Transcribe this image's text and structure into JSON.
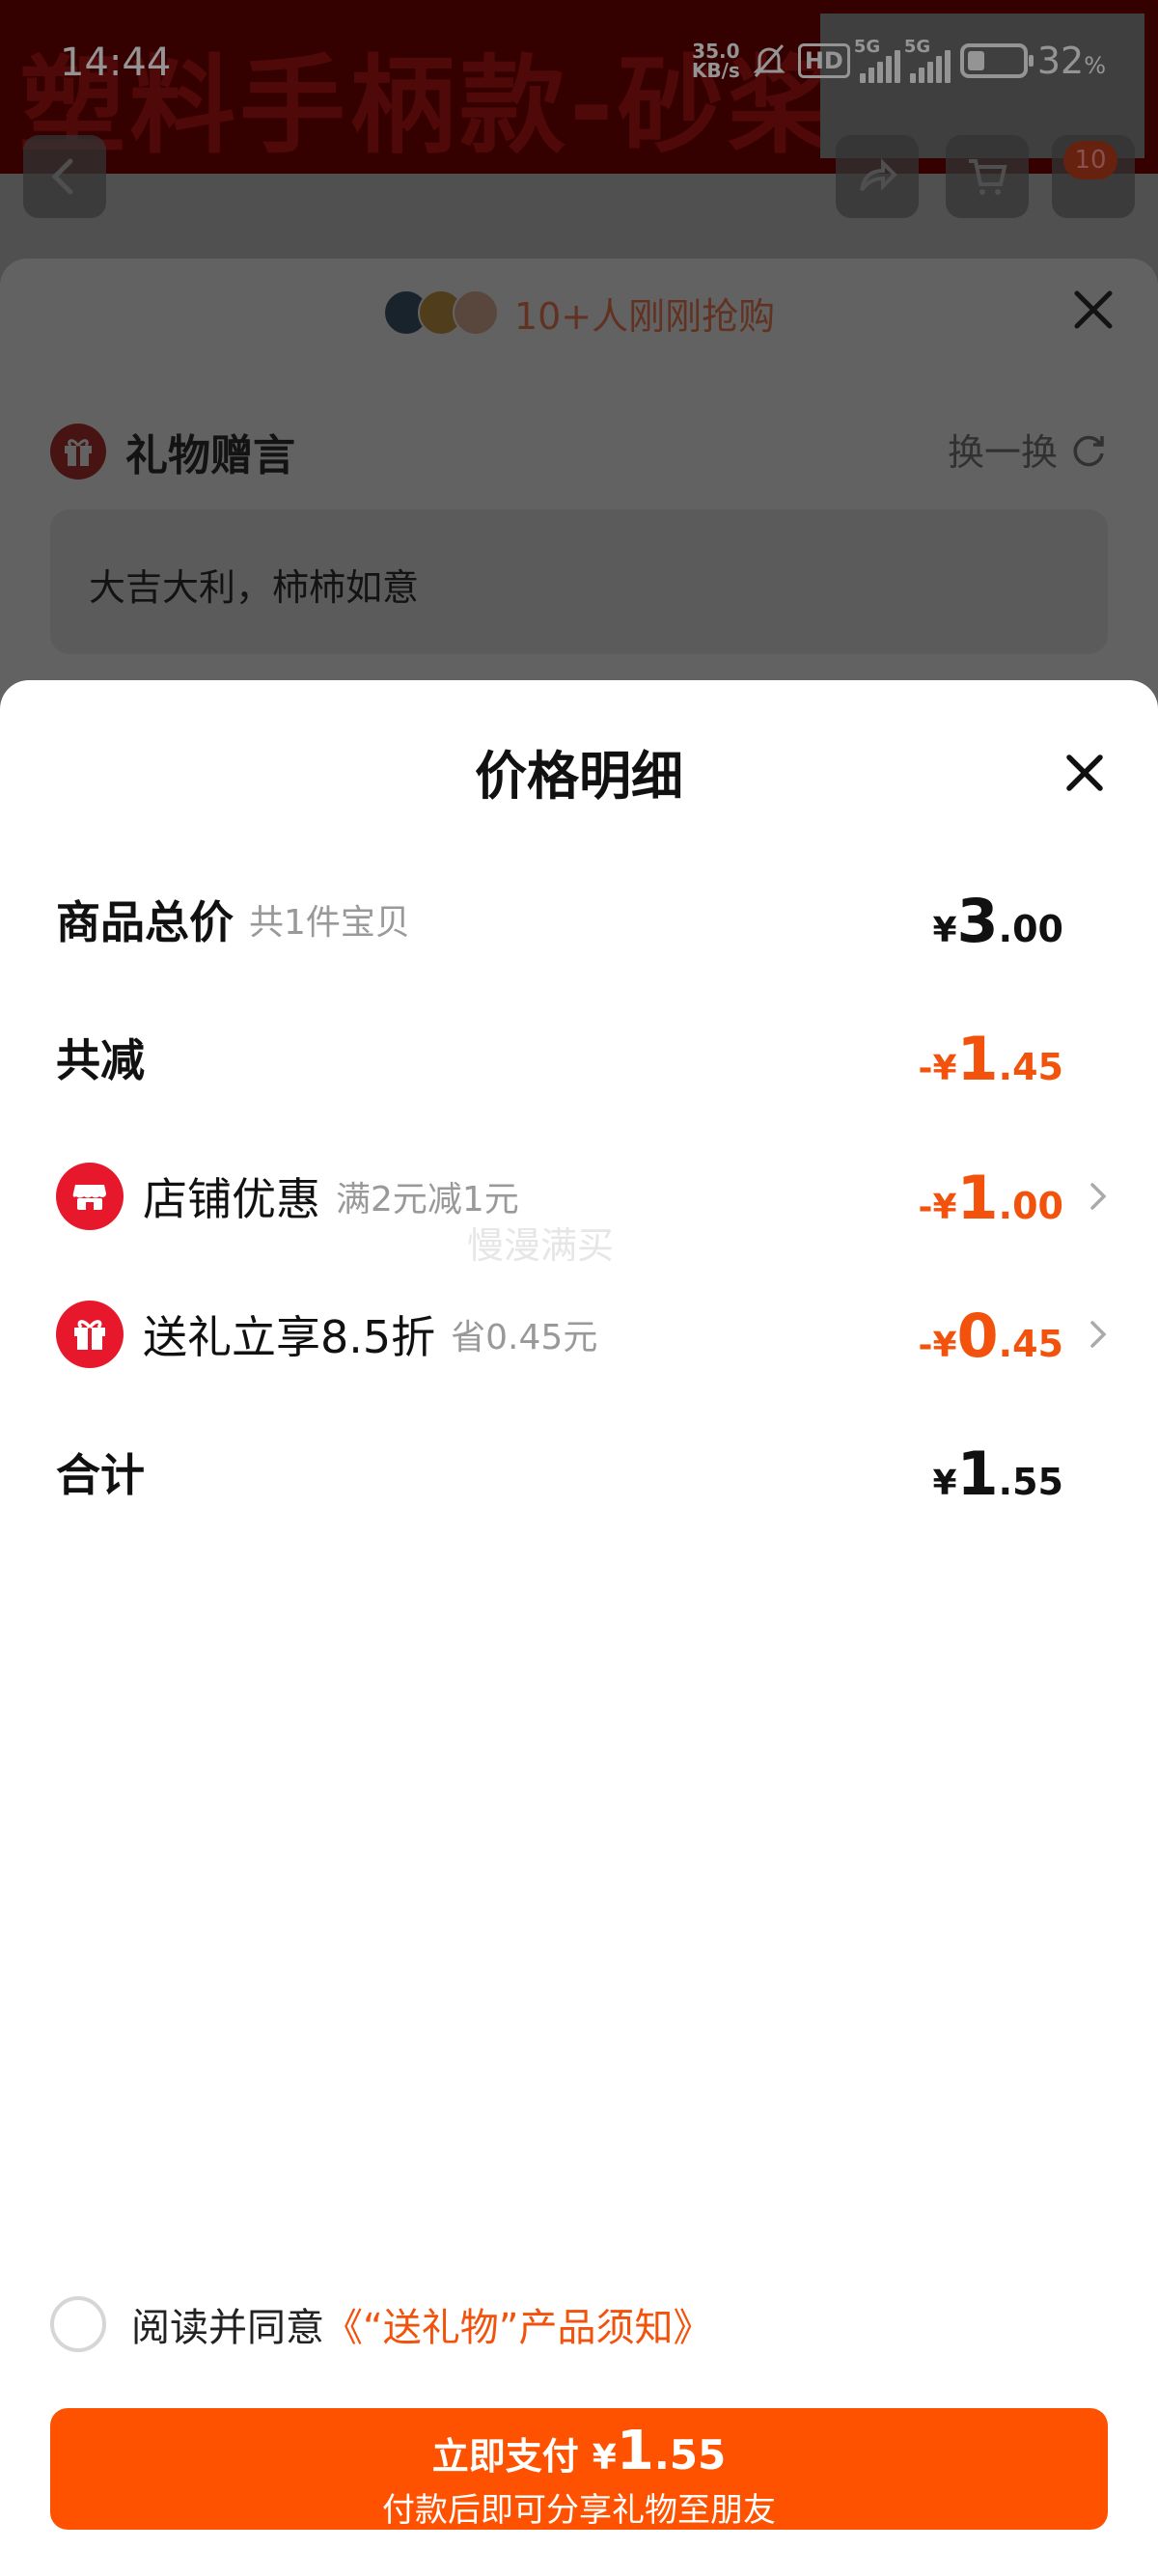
{
  "status_bar": {
    "time": "14:44",
    "net_speed_value": "35.0",
    "net_speed_unit": "KB/s",
    "hd_label": "HD",
    "signal1_label": "5G",
    "signal2_label": "5G",
    "battery_level": 0.32,
    "battery_pct": "32",
    "battery_unit": "%"
  },
  "background": {
    "product_title": "塑料手柄款-砂桨",
    "cart_badge": "10"
  },
  "gift_sheet": {
    "buyers_text": "10+人刚刚抢购",
    "message_title": "礼物赠言",
    "swap_label": "换一换",
    "message_text": "大吉大利，柿柿如意"
  },
  "price_detail": {
    "title": "价格明细",
    "total": {
      "label": "商品总价",
      "sub": "共1件宝贝",
      "currency": "¥",
      "int": "3",
      "dec": ".00"
    },
    "discount_total": {
      "label": "共减",
      "currency": "-¥",
      "int": "1",
      "dec": ".45"
    },
    "items": [
      {
        "label": "店铺优惠",
        "sub": "满2元减1元",
        "currency": "-¥",
        "int": "1",
        "dec": ".00",
        "icon": "shop-icon"
      },
      {
        "label": "送礼立享8.5折",
        "sub": "省0.45元",
        "currency": "-¥",
        "int": "0",
        "dec": ".45",
        "icon": "gift-icon"
      }
    ],
    "sum": {
      "label": "合计",
      "currency": "¥",
      "int": "1",
      "dec": ".55"
    },
    "watermark": "慢漫满买"
  },
  "agreement": {
    "text": "阅读并同意",
    "link": "《“送礼物”产品须知》"
  },
  "pay_button": {
    "label": "立即支付",
    "currency": "¥",
    "int": "1",
    "dec": ".55",
    "subtitle": "付款后即可分享礼物至朋友"
  },
  "colors": {
    "accent": "#ff5200",
    "discount": "#f2520c",
    "icon_red": "#e8182c"
  }
}
